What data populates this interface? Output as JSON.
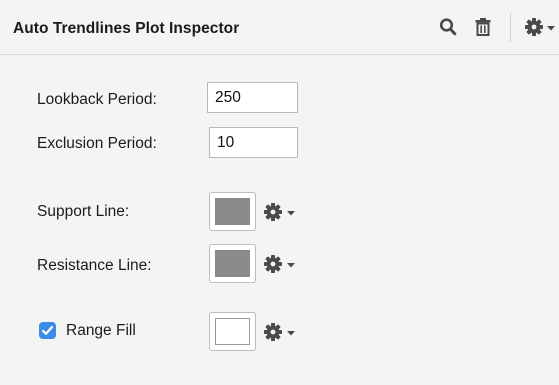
{
  "inspector": {
    "title": "Auto Trendlines Plot Inspector",
    "header_icons": [
      "search-icon",
      "trash-icon",
      "gear-icon",
      "chevron-down-icon"
    ]
  },
  "fields": {
    "lookback": {
      "label": "Lookback Period:",
      "value": "250"
    },
    "exclusion": {
      "label": "Exclusion Period:",
      "value": "10"
    }
  },
  "lines": {
    "support": {
      "label": "Support Line:",
      "color": "#8a8a8a"
    },
    "resistance": {
      "label": "Resistance Line:",
      "color": "#8a8a8a"
    }
  },
  "range_fill": {
    "label": "Range Fill",
    "checked": true,
    "color": "#ffffff",
    "checkbox_color": "#3b8ce8"
  }
}
